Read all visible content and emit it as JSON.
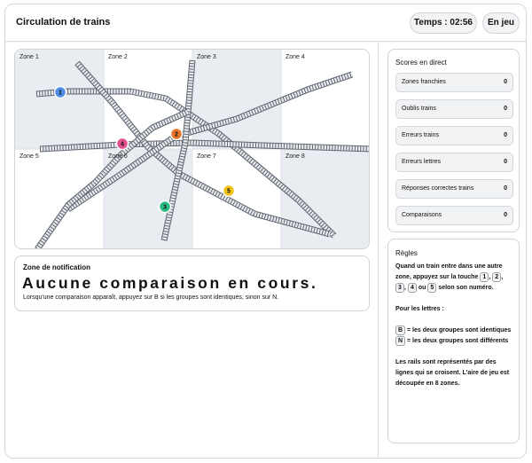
{
  "header": {
    "title": "Circulation de trains",
    "timer": "Temps : 02:56",
    "status": "En jeu"
  },
  "zones": [
    "Zone 1",
    "Zone 2",
    "Zone 3",
    "Zone 4",
    "Zone 5",
    "Zone 6",
    "Zone 7",
    "Zone 8"
  ],
  "trains": [
    {
      "label": "1",
      "color": "#4f8fe6"
    },
    {
      "label": "2",
      "color": "#e8732a"
    },
    {
      "label": "3",
      "color": "#2dbd84"
    },
    {
      "label": "4",
      "color": "#e0508f"
    },
    {
      "label": "5",
      "color": "#f2c21b"
    }
  ],
  "notification": {
    "title": "Zone de notification",
    "message": "Aucune comparaison en cours.",
    "hint": "Lorsqu'une comparaison apparaît, appuyez sur B si les groupes sont identiques, sinon sur N."
  },
  "scores": {
    "title": "Scores en direct",
    "rows": [
      {
        "label": "Zones franchies",
        "value": "0"
      },
      {
        "label": "Oublis trains",
        "value": "0"
      },
      {
        "label": "Erreurs trains",
        "value": "0"
      },
      {
        "label": "Erreurs lettres",
        "value": "0"
      },
      {
        "label": "Réponses correctes trains",
        "value": "0"
      },
      {
        "label": "Comparaisons",
        "value": "0"
      }
    ]
  },
  "rules": {
    "title": "Règles",
    "intro": "Quand un train entre dans une autre zone, appuyez sur la touche",
    "keys": [
      "1",
      "2",
      "3",
      "4",
      "5"
    ],
    "sep_comma": ",",
    "sep_or": "ou",
    "suffix": "selon son numéro.",
    "letters_heading": "Pour les lettres :",
    "key_b": "B",
    "b_text": "= les deux groupes sont identiques",
    "key_n": "N",
    "n_text": "= les deux groupes sont différents",
    "outro": "Les rails sont représentés par des lignes qui se croisent. L'aire de jeu est découpée en 8 zones."
  },
  "colors": {
    "zone_shade": "#e9ecf1",
    "rail": "#5f6670",
    "accent_border": "#cfd3d8"
  }
}
